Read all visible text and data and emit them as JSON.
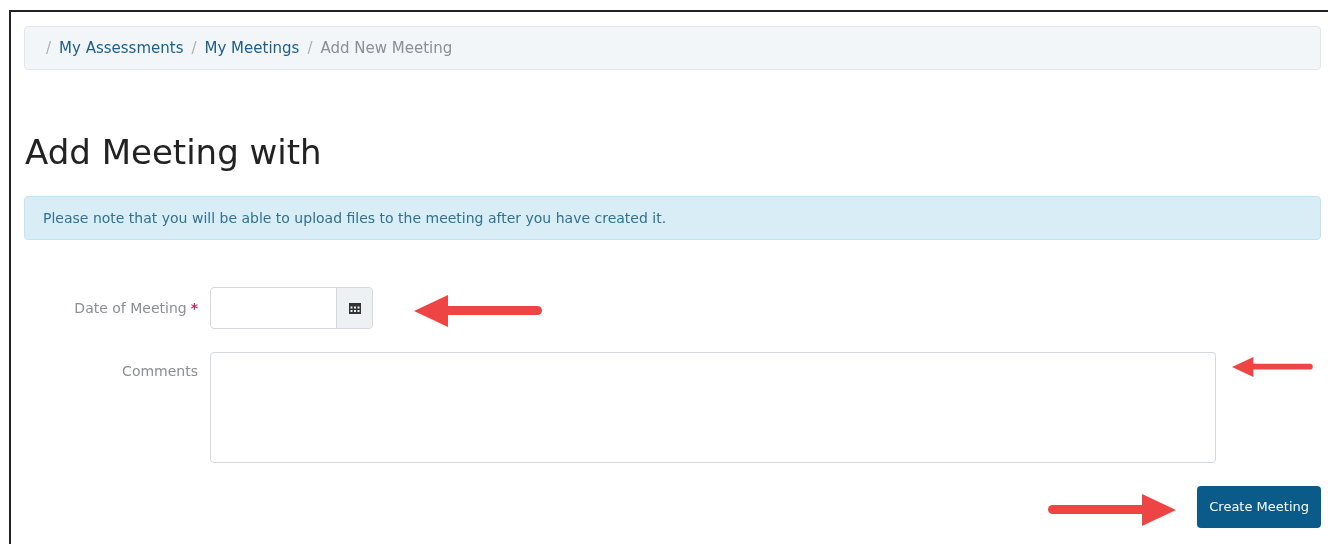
{
  "breadcrumb": [
    {
      "separator": "/",
      "label": "My Assessments",
      "kind": "link"
    },
    {
      "separator": "/",
      "label": "My Meetings",
      "kind": "link"
    },
    {
      "separator": "/",
      "label": "Add New Meeting",
      "kind": "current"
    }
  ],
  "heading": "Add Meeting with",
  "notice": "Please note that you will be able to upload files to the meeting after you have created it.",
  "form": {
    "fields": [
      {
        "label": "Date of Meeting",
        "required_mark": "*",
        "kind": "date"
      },
      {
        "label": "Comments",
        "kind": "textarea"
      }
    ],
    "submit": "Create Meeting"
  }
}
